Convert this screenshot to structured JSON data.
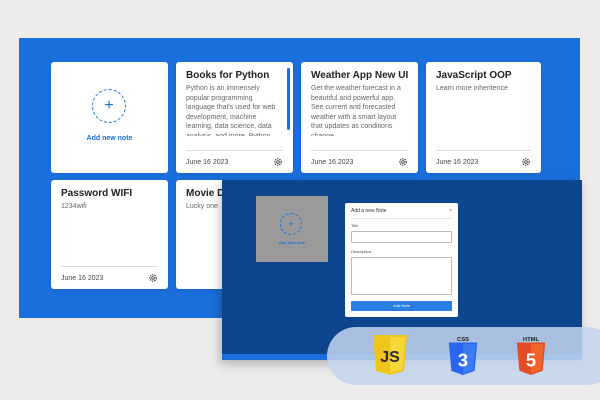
{
  "add_note": {
    "label": "Add new note"
  },
  "notes": [
    {
      "title": "Books for Python",
      "description": "Python is an immensely popular programming language that's used for web development, machine learning, data science, data analysis, and more. Python also ranked as",
      "date": "June 16 2023"
    },
    {
      "title": "Weather App New UI",
      "description": "Get the weather forecast in a beautiful and powerful app. See current and forecasted weather with a smart layout that updates as conditions change.",
      "date": "June 16 2023"
    },
    {
      "title": "JavaScript OOP",
      "description": "Learn more inheritence",
      "date": "June 16 2023"
    },
    {
      "title": "Password WIFI",
      "description": "1234wifi",
      "date": "June 16 2023"
    },
    {
      "title": "Movie D",
      "description": "Lucky one",
      "date": ""
    }
  ],
  "overlay": {
    "add_label": "Add new note",
    "modal": {
      "title": "Add a new Note",
      "close": "×",
      "title_label": "Title",
      "description_label": "Description",
      "button_label": "Add Note"
    }
  },
  "badges": [
    {
      "name": "js-logo",
      "label": "JS",
      "top": "JS",
      "color": "#f0c419",
      "dark": "#d9a90f",
      "text": "#2b2b2b"
    },
    {
      "name": "css3-logo",
      "label": "3",
      "top": "CSS",
      "color": "#2965f1",
      "dark": "#1b4fc9",
      "text": "#ffffff"
    },
    {
      "name": "html5-logo",
      "label": "5",
      "top": "HTML",
      "color": "#e34c26",
      "dark": "#c13a18",
      "text": "#ffffff"
    }
  ],
  "colors": {
    "accent": "#1a6fdc",
    "overlay_bg": "#0e468e",
    "button": "#2a7de1"
  }
}
